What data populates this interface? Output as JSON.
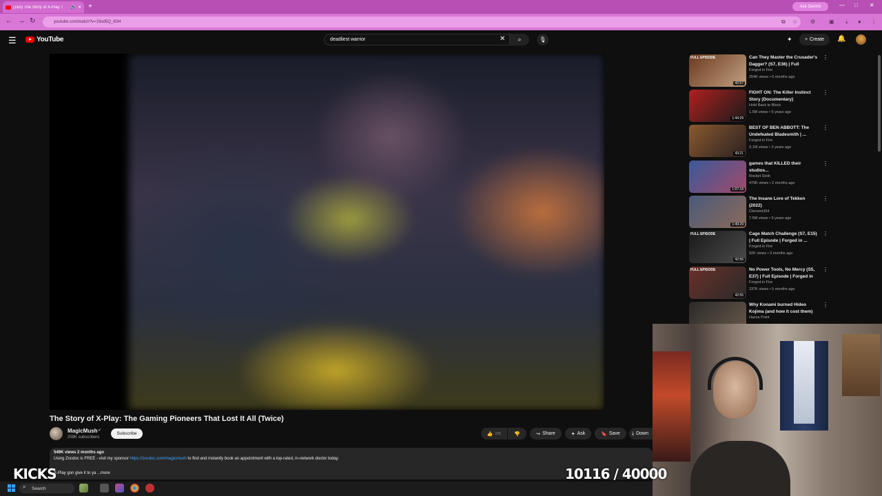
{
  "browser": {
    "tab_title": "(163) The Story of X-Play T",
    "new_tab": "+",
    "ask_gemini": "Ask Gemini",
    "url": "youtube.com/watch?v=19od5Q_60l4",
    "window_controls": [
      "—",
      "□",
      "✕"
    ]
  },
  "header": {
    "logo_text": "YouTube",
    "search_value": "deadliest warrior",
    "create_label": "Create"
  },
  "video": {
    "title": "The Story of X-Play: The Gaming Pioneers That Lost It All (Twice)",
    "channel": "MagicMush",
    "subscribers": "259K subscribers",
    "subscribe_label": "Subscribe",
    "like_count": "22K",
    "share_label": "Share",
    "ask_label": "Ask",
    "save_label": "Save",
    "download_label": "Down",
    "desc_meta": "549K views  2 months ago",
    "desc_prefix": "Using Zocdoc is FREE - visit my sponsor ",
    "desc_link": "https://zocdoc.com/magicmush",
    "desc_suffix": " to find and instantly book an appointment with a top-rated, in-network doctor today.",
    "desc_line2": "X-Play gon give it to ya  ...more"
  },
  "recommendations": [
    {
      "thumb_label": "FULL EPISODE",
      "title": "Can They Master the Crusader's Dagger? (S7, E36) | Full Episod...",
      "channel": "Forged in Fire",
      "meta": "254K views • 6 months ago",
      "duration": "42:57",
      "colors": [
        "#6a3a20",
        "#c2a080"
      ]
    },
    {
      "thumb_label": "",
      "title": "FIGHT ON: The Killer Instinct Story (Documentary)",
      "channel": "Hold Back to Block",
      "meta": "1.5M views • 5 years ago",
      "duration": "1:44:29",
      "colors": [
        "#b02020",
        "#1a1a1a"
      ]
    },
    {
      "thumb_label": "",
      "title": "BEST OF BEN ABBOTT: The Undefeated Bladesmith | ...",
      "channel": "Forged in Fire",
      "meta": "3.1M views • 3 years ago",
      "duration": "43:21",
      "colors": [
        "#8a5a30",
        "#2a2020"
      ]
    },
    {
      "thumb_label": "",
      "title": "games that KILLED their studios...",
      "channel": "Rocket Sloth",
      "meta": "479K views • 2 months ago",
      "duration": "1:07:18",
      "colors": [
        "#3a5a9a",
        "#a04a6a"
      ]
    },
    {
      "thumb_label": "",
      "title": "The Insane Lore of Tekken (2022)",
      "channel": "ClementJ64",
      "meta": "7.5M views • 3 years ago",
      "duration": "1:49:29",
      "colors": [
        "#4a5a7a",
        "#8a6a5a"
      ]
    },
    {
      "thumb_label": "FULL EPISODE",
      "title": "Cage Match Challenge (S7, E15) | Full Episode | Forged in ...",
      "channel": "Forged in Fire",
      "meta": "92K views • 3 months ago",
      "duration": "42:56",
      "colors": [
        "#1a1a1a",
        "#4a4a4a"
      ]
    },
    {
      "thumb_label": "FULL EPISODE",
      "title": "No Power Tools, No Mercy (S5, E37) | Full Episode | Forged in ...",
      "channel": "Forged in Fire",
      "meta": "237K views • 5 months ago",
      "duration": "42:55",
      "colors": [
        "#6a3028",
        "#2a2a2a"
      ]
    },
    {
      "thumb_label": "",
      "title": "Why Konami burned Hideo Kojima (and how it cost them)",
      "channel": "Hazza Point",
      "meta": "",
      "duration": "",
      "colors": [
        "#2a2a2a",
        "#6a5a4a"
      ]
    }
  ],
  "overlay": {
    "kicks": "KICKS",
    "counter": "10116 / 40000"
  },
  "taskbar": {
    "search_label": "Search"
  }
}
